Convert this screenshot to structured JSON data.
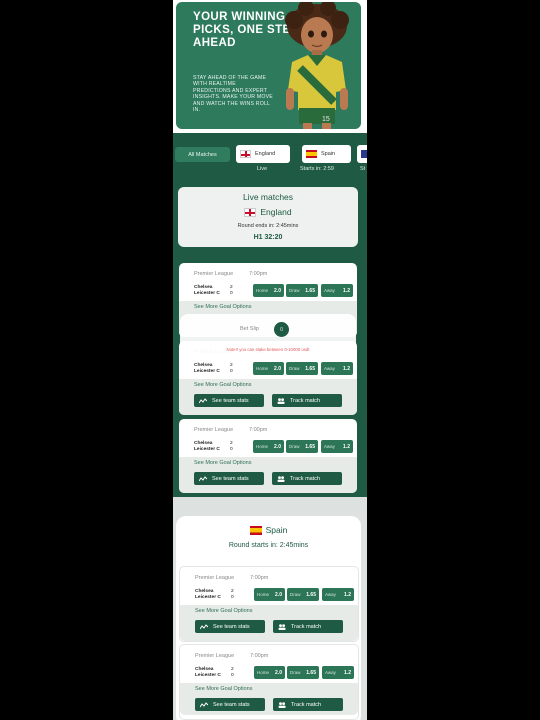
{
  "hero": {
    "title": "YOUR WINNING PICKS, ONE STEP AHEAD",
    "subtitle": "STAY AHEAD OF THE GAME WITH REALTIME PREDICTIONS AND EXPERT INSIGHTS. MAKE YOUR MOVE AND WATCH THE WINS ROLL IN.",
    "jersey_number": "15"
  },
  "tabs": [
    {
      "label": "All Matches",
      "caption": ""
    },
    {
      "label": "England",
      "caption": "Live"
    },
    {
      "label": "Spain",
      "caption": "Starts in:  2:59"
    },
    {
      "label": "",
      "caption": "St"
    }
  ],
  "live": {
    "title": "Live matches",
    "country": "England",
    "ends_label": "Round ends in:  2:45mins",
    "time": "H1 32:20"
  },
  "match": {
    "league": "Premier League",
    "kickoff": "7:00pm",
    "home_team": "Chelsea",
    "away_team": "Leicester C",
    "home_score": "2",
    "away_score": "0",
    "home_label": "Home",
    "home_odds": "2.0",
    "draw_label": "Draw",
    "draw_odds": "1.65",
    "away_label": "Away",
    "away_odds": "1.2",
    "goal_options": "See More Goal Options",
    "stats_button": "See team stats",
    "track_button": "Track match"
  },
  "betslip": {
    "label": "Bet Slip",
    "count": "0",
    "note": "Note!! you can stake between 0-10000 usdt"
  },
  "spain": {
    "country": "Spain",
    "starts_label": "Round starts in:  2:45mins"
  },
  "colors": {
    "brand_green": "#1f5b44",
    "accent_green": "#2d7557",
    "warning": "#e05a5a"
  }
}
